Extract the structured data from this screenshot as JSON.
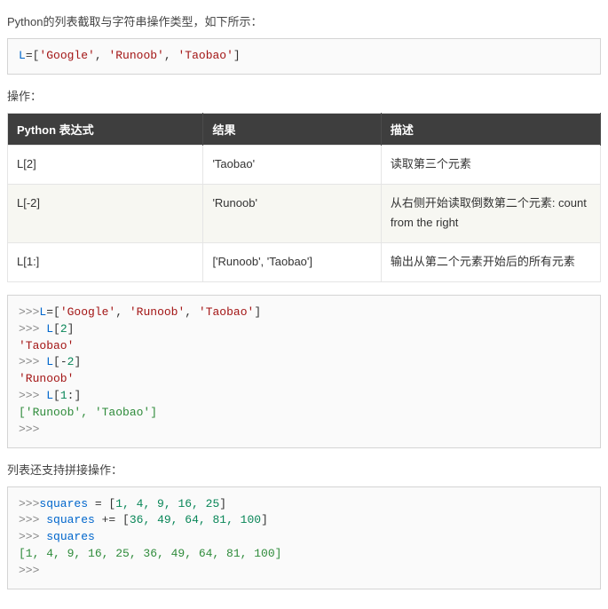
{
  "intro": "Python的列表截取与字符串操作类型，如下所示：",
  "code1": {
    "line1": {
      "id": "L",
      "op": "=[",
      "s1": "'Google'",
      "c1": ", ",
      "s2": "'Runoob'",
      "c2": ", ",
      "s3": "'Taobao'",
      "close": "]"
    }
  },
  "ops_label": "操作：",
  "table": {
    "headers": {
      "expr": "Python 表达式",
      "result": "结果",
      "desc": "描述"
    },
    "rows": [
      {
        "expr": "L[2]",
        "result": "'Taobao'",
        "desc": "读取第三个元素"
      },
      {
        "expr": "L[-2]",
        "result": "'Runoob'",
        "desc": "从右侧开始读取倒数第二个元素: count from the right"
      },
      {
        "expr": "L[1:]",
        "result": "['Runoob', 'Taobao']",
        "desc": "输出从第二个元素开始后的所有元素"
      }
    ]
  },
  "code2": {
    "p": ">>>",
    "p2": ">>> ",
    "l1": {
      "id": "L",
      "op": "=[",
      "s1": "'Google'",
      "c1": ", ",
      "s2": "'Runoob'",
      "c2": ", ",
      "s3": "'Taobao'",
      "close": "]"
    },
    "l2": {
      "id": "L",
      "br": "[",
      "n": "2",
      "br2": "]"
    },
    "o2": "'Taobao'",
    "l3": {
      "id": "L",
      "br": "[",
      "op": "-",
      "n": "2",
      "br2": "]"
    },
    "o3": "'Runoob'",
    "l4": {
      "id": "L",
      "br": "[",
      "n": "1",
      "op": ":",
      "br2": "]"
    },
    "o4": "['Runoob', 'Taobao']"
  },
  "concat_label": "列表还支持拼接操作：",
  "code3": {
    "p": ">>>",
    "p2": ">>> ",
    "l1": {
      "id": "squares",
      "eq": " = ",
      "br": "[",
      "v": "1, 4, 9, 16, 25",
      "br2": "]"
    },
    "l2": {
      "id": "squares",
      "eq": " += ",
      "br": "[",
      "v": "36, 49, 64, 81, 100",
      "br2": "]"
    },
    "l3": {
      "id": "squares"
    },
    "o": "[1, 4, 9, 16, 25, 36, 49, 64, 81, 100]"
  }
}
